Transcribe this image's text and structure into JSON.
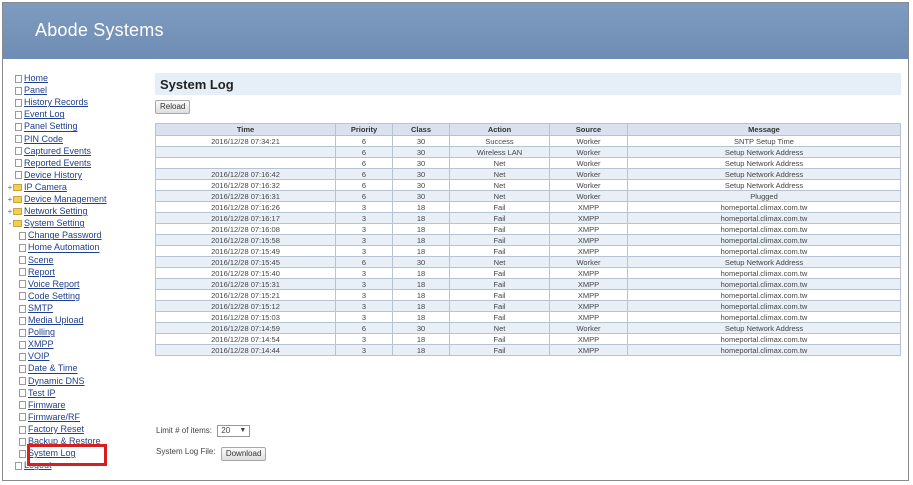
{
  "app_title": "Abode Systems",
  "sidebar": {
    "items": [
      {
        "label": "Home",
        "kind": "page",
        "level": 0
      },
      {
        "label": "Panel",
        "kind": "page",
        "level": 0
      },
      {
        "label": "History Records",
        "kind": "page",
        "level": 0
      },
      {
        "label": "Event Log",
        "kind": "page",
        "level": 0
      },
      {
        "label": "Panel Setting",
        "kind": "page",
        "level": 0
      },
      {
        "label": "PIN Code",
        "kind": "page",
        "level": 0
      },
      {
        "label": "Captured Events",
        "kind": "page",
        "level": 0
      },
      {
        "label": "Reported Events",
        "kind": "page",
        "level": 0
      },
      {
        "label": "Device History",
        "kind": "page",
        "level": 0
      },
      {
        "label": "IP Camera",
        "kind": "folder",
        "toggle": "+",
        "level": 0
      },
      {
        "label": "Device Management",
        "kind": "folder",
        "toggle": "+",
        "level": 0
      },
      {
        "label": "Network Setting",
        "kind": "folder",
        "toggle": "+",
        "level": 0
      },
      {
        "label": "System Setting",
        "kind": "folder",
        "toggle": "-",
        "level": 0
      },
      {
        "label": "Change Password",
        "kind": "page",
        "level": 1
      },
      {
        "label": "Home Automation",
        "kind": "page",
        "level": 1
      },
      {
        "label": "Scene",
        "kind": "page",
        "level": 1
      },
      {
        "label": "Report",
        "kind": "page",
        "level": 1
      },
      {
        "label": "Voice Report",
        "kind": "page",
        "level": 1
      },
      {
        "label": "Code Setting",
        "kind": "page",
        "level": 1
      },
      {
        "label": "SMTP",
        "kind": "page",
        "level": 1
      },
      {
        "label": "Media Upload",
        "kind": "page",
        "level": 1
      },
      {
        "label": "Polling",
        "kind": "page",
        "level": 1
      },
      {
        "label": "XMPP",
        "kind": "page",
        "level": 1
      },
      {
        "label": "VOIP",
        "kind": "page",
        "level": 1
      },
      {
        "label": "Date & Time",
        "kind": "page",
        "level": 1
      },
      {
        "label": "Dynamic DNS",
        "kind": "page",
        "level": 1
      },
      {
        "label": "Test IP",
        "kind": "page",
        "level": 1
      },
      {
        "label": "Firmware",
        "kind": "page",
        "level": 1
      },
      {
        "label": "Firmware/RF",
        "kind": "page",
        "level": 1
      },
      {
        "label": "Factory Reset",
        "kind": "page",
        "level": 1
      },
      {
        "label": "Backup & Restore",
        "kind": "page",
        "level": 1
      },
      {
        "label": "System Log",
        "kind": "page",
        "level": 1
      },
      {
        "label": "Logout",
        "kind": "page",
        "level": 0
      }
    ]
  },
  "page": {
    "title": "System Log",
    "reload_label": "Reload",
    "limit_label": "Limit # of items:",
    "limit_value": "20",
    "file_label": "System Log File:",
    "download_label": "Download"
  },
  "table": {
    "headers": [
      "Time",
      "Priority",
      "Class",
      "Action",
      "Source",
      "Message"
    ],
    "rows": [
      [
        "2016/12/28 07:34:21",
        "6",
        "30",
        "Success",
        "Worker",
        "SNTP Setup Time"
      ],
      [
        "",
        "6",
        "30",
        "Wireless LAN",
        "Worker",
        "Setup Network Address"
      ],
      [
        "",
        "6",
        "30",
        "Net",
        "Worker",
        "Setup Network Address"
      ],
      [
        "2016/12/28 07:16:42",
        "6",
        "30",
        "Net",
        "Worker",
        "Setup Network Address"
      ],
      [
        "2016/12/28 07:16:32",
        "6",
        "30",
        "Net",
        "Worker",
        "Setup Network Address"
      ],
      [
        "2016/12/28 07:16:31",
        "6",
        "30",
        "Net",
        "Worker",
        "Plugged"
      ],
      [
        "2016/12/28 07:16:26",
        "3",
        "18",
        "Fail",
        "XMPP",
        "homeportal.climax.com.tw"
      ],
      [
        "2016/12/28 07:16:17",
        "3",
        "18",
        "Fail",
        "XMPP",
        "homeportal.climax.com.tw"
      ],
      [
        "2016/12/28 07:16:08",
        "3",
        "18",
        "Fail",
        "XMPP",
        "homeportal.climax.com.tw"
      ],
      [
        "2016/12/28 07:15:58",
        "3",
        "18",
        "Fail",
        "XMPP",
        "homeportal.climax.com.tw"
      ],
      [
        "2016/12/28 07:15:49",
        "3",
        "18",
        "Fail",
        "XMPP",
        "homeportal.climax.com.tw"
      ],
      [
        "2016/12/28 07:15:45",
        "6",
        "30",
        "Net",
        "Worker",
        "Setup Network Address"
      ],
      [
        "2016/12/28 07:15:40",
        "3",
        "18",
        "Fail",
        "XMPP",
        "homeportal.climax.com.tw"
      ],
      [
        "2016/12/28 07:15:31",
        "3",
        "18",
        "Fail",
        "XMPP",
        "homeportal.climax.com.tw"
      ],
      [
        "2016/12/28 07:15:21",
        "3",
        "18",
        "Fail",
        "XMPP",
        "homeportal.climax.com.tw"
      ],
      [
        "2016/12/28 07:15:12",
        "3",
        "18",
        "Fail",
        "XMPP",
        "homeportal.climax.com.tw"
      ],
      [
        "2016/12/28 07:15:03",
        "3",
        "18",
        "Fail",
        "XMPP",
        "homeportal.climax.com.tw"
      ],
      [
        "2016/12/28 07:14:59",
        "6",
        "30",
        "Net",
        "Worker",
        "Setup Network Address"
      ],
      [
        "2016/12/28 07:14:54",
        "3",
        "18",
        "Fail",
        "XMPP",
        "homeportal.climax.com.tw"
      ],
      [
        "2016/12/28 07:14:44",
        "3",
        "18",
        "Fail",
        "XMPP",
        "homeportal.climax.com.tw"
      ]
    ]
  },
  "colors": {
    "banner": "#7290b6",
    "highlight": "#d62020",
    "link": "#1f3f8f"
  }
}
